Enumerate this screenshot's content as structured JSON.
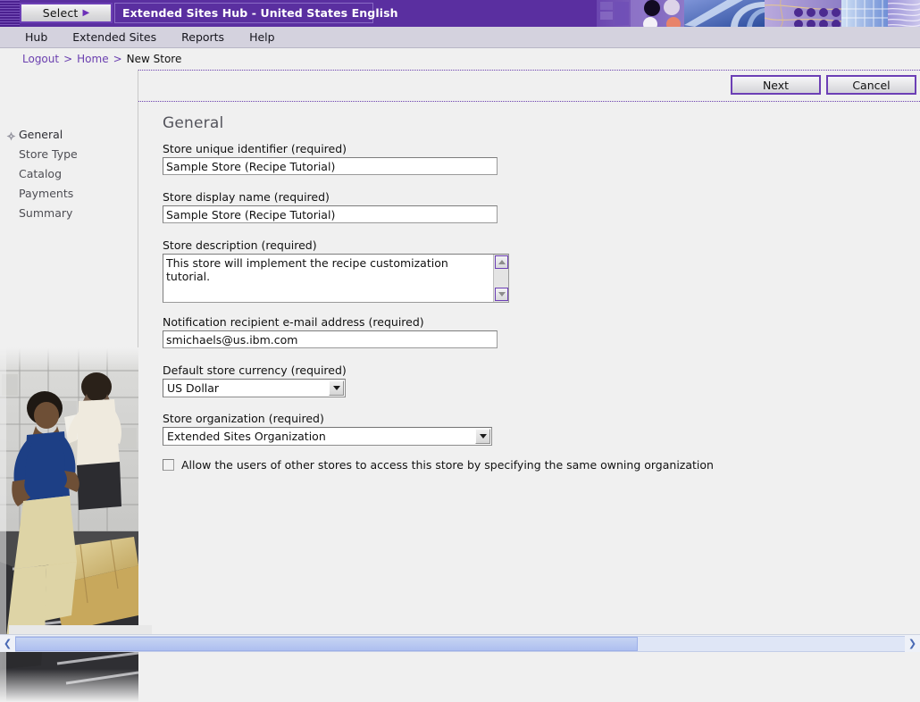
{
  "titlebar": {
    "select_button_label": "Select",
    "select_button_arrow": "▶",
    "title": "Extended Sites Hub - United States English"
  },
  "menubar": {
    "items": [
      {
        "label": "Hub"
      },
      {
        "label": "Extended Sites"
      },
      {
        "label": "Reports"
      },
      {
        "label": "Help"
      }
    ]
  },
  "breadcrumb": {
    "logout": "Logout",
    "sep1": ">",
    "home": "Home",
    "sep2": ">",
    "current": "New Store"
  },
  "sidebar": {
    "items": [
      {
        "label": "General",
        "active": true
      },
      {
        "label": "Store Type",
        "active": false
      },
      {
        "label": "Catalog",
        "active": false
      },
      {
        "label": "Payments",
        "active": false
      },
      {
        "label": "Summary",
        "active": false
      }
    ]
  },
  "toolbar": {
    "next_label": "Next",
    "cancel_label": "Cancel"
  },
  "main": {
    "page_title": "General",
    "fields": {
      "store_identifier": {
        "label": "Store unique identifier (required)",
        "value": "Sample Store (Recipe Tutorial)"
      },
      "store_display_name": {
        "label": "Store display name (required)",
        "value": "Sample Store (Recipe Tutorial)"
      },
      "store_description": {
        "label": "Store description (required)",
        "value": "This store will implement the recipe customization tutorial."
      },
      "notification_email": {
        "label": "Notification recipient e-mail address (required)",
        "value": "smichaels@us.ibm.com"
      },
      "default_currency": {
        "label": "Default store currency (required)",
        "value": "US Dollar"
      },
      "store_organization": {
        "label": "Store organization (required)",
        "value": "Extended Sites Organization"
      },
      "allow_other_stores": {
        "label": "Allow the users of other stores to access this store by specifying the same owning organization",
        "checked": false
      }
    }
  },
  "colors": {
    "titlebar_purple": "#5a2fa0",
    "menubar_lavender": "#d4d2de",
    "accent_purple": "#6c3fb5",
    "link_purple": "#6a3faf",
    "page_background": "#f0f0f0",
    "scrollbar_blue": "#aebff0"
  }
}
